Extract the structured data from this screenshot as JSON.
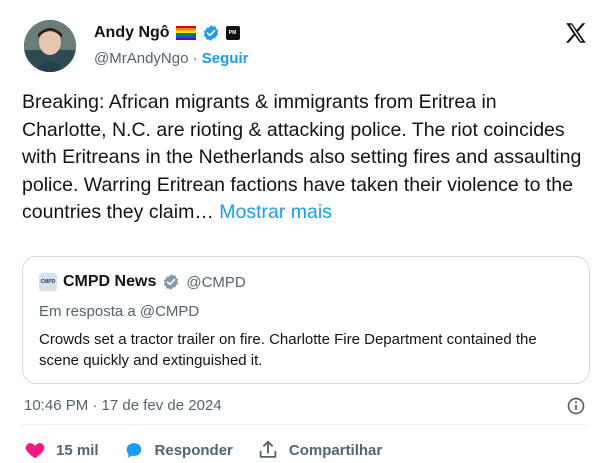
{
  "author": {
    "name": "Andy Ngô",
    "handle": "@MrAndyNgo",
    "separator": "·",
    "follow_label": "Seguir"
  },
  "tweet": {
    "text": "Breaking: African migrants & immigrants from Eritrea in Charlotte, N.C. are rioting & attacking police. The riot coincides with Eritreans in the Netherlands also setting fires and assaulting police. Warring Eritrean factions have taken their violence to the countries they claim… ",
    "show_more": "Mostrar mais",
    "timestamp": "10:46 PM · 17 de fev de 2024"
  },
  "quote": {
    "name": "CMPD News",
    "handle": "@CMPD",
    "reply_to": "Em resposta a @CMPD",
    "text": "Crowds set a tractor trailer on fire. Charlotte Fire Department contained the scene quickly and extinguished it."
  },
  "actions": {
    "like_count": "15 mil",
    "reply_label": "Responder",
    "share_label": "Compartilhar"
  },
  "colors": {
    "accent": "#1d9bf0",
    "secondary_text": "#536471",
    "like": "#f91880"
  }
}
